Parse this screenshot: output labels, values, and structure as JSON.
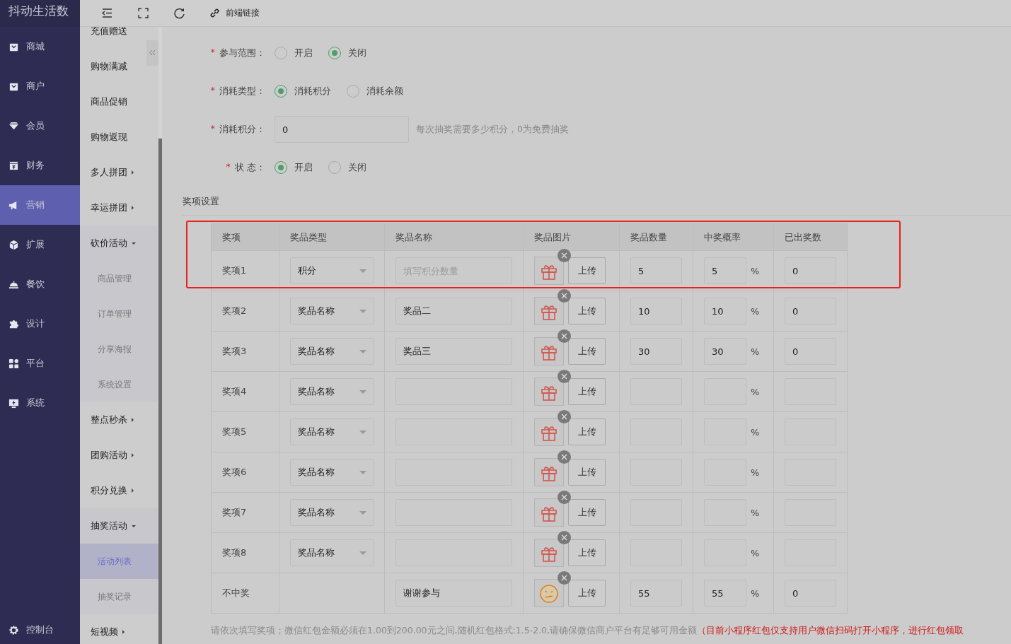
{
  "app": {
    "logo": "抖动生活数"
  },
  "main_menu": [
    {
      "label": "商城",
      "selected": false
    },
    {
      "label": "商户",
      "selected": false
    },
    {
      "label": "会员",
      "selected": false
    },
    {
      "label": "财务",
      "selected": false
    },
    {
      "label": "营销",
      "selected": true
    },
    {
      "label": "扩展",
      "selected": false
    },
    {
      "label": "餐饮",
      "selected": false
    },
    {
      "label": "设计",
      "selected": false
    },
    {
      "label": "平台",
      "selected": false
    },
    {
      "label": "系统",
      "selected": false
    }
  ],
  "console": {
    "label": "控制台"
  },
  "toolbar": {
    "link_label": "前端链接"
  },
  "sub_menu": [
    {
      "label": "充值赠送",
      "selected": false
    },
    {
      "label": "购物满减",
      "selected": false
    },
    {
      "label": "商品促销",
      "selected": false
    },
    {
      "label": "购物返现",
      "selected": false
    },
    {
      "label": "多人拼团",
      "expanded": false
    },
    {
      "label": "幸运拼团",
      "expanded": false
    },
    {
      "label": "砍价活动",
      "expanded": true,
      "children": [
        {
          "label": "商品管理",
          "selected": false
        },
        {
          "label": "订单管理",
          "selected": false
        },
        {
          "label": "分享海报",
          "selected": false
        },
        {
          "label": "系统设置",
          "selected": false
        }
      ]
    },
    {
      "label": "整点秒杀",
      "expanded": false
    },
    {
      "label": "团购活动",
      "expanded": false
    },
    {
      "label": "积分兑换",
      "expanded": false
    },
    {
      "label": "抽奖活动",
      "expanded": true,
      "children": [
        {
          "label": "活动列表",
          "selected": true
        },
        {
          "label": "抽奖记录",
          "selected": false
        }
      ]
    },
    {
      "label": "短视频",
      "expanded": false
    }
  ],
  "form": [
    {
      "kind": "radio",
      "required_mark": "*",
      "label": "参与范围：",
      "options": [
        {
          "label": "开启",
          "selected": false
        },
        {
          "label": "关闭",
          "selected": true
        }
      ]
    },
    {
      "kind": "radio",
      "required_mark": "*",
      "label": "消耗类型：",
      "options": [
        {
          "label": "消耗积分",
          "selected": true
        },
        {
          "label": "消耗余额",
          "selected": false
        }
      ]
    },
    {
      "kind": "input",
      "required_mark": "*",
      "label": "消耗积分：",
      "value": "0",
      "hint": "每次抽奖需要多少积分，0为免费抽奖"
    },
    {
      "kind": "radio",
      "required_mark": "*",
      "label": "状 态：",
      "options": [
        {
          "label": "开启",
          "selected": true
        },
        {
          "label": "关闭",
          "selected": false
        }
      ]
    }
  ],
  "prizes": {
    "title": "奖项设置",
    "columns": [
      "奖项",
      "奖品类型",
      "奖品名称",
      "奖品图片",
      "奖品数量",
      "中奖概率",
      "已出奖数"
    ],
    "rows": [
      {
        "kind": "prize",
        "label": "奖项1",
        "type": "积分",
        "name_placeholder": "填写积分数量",
        "upload": "上传",
        "quantity": "5",
        "probability": "5",
        "unit": "%",
        "awarded": "0",
        "highlighted": true
      },
      {
        "kind": "prize",
        "label": "奖项2",
        "type": "奖品名称",
        "name": "奖品二",
        "upload": "上传",
        "quantity": "10",
        "probability": "10",
        "unit": "%",
        "awarded": "0",
        "highlighted": false
      },
      {
        "kind": "prize",
        "label": "奖项3",
        "type": "奖品名称",
        "name": "奖品三",
        "upload": "上传",
        "quantity": "30",
        "probability": "30",
        "unit": "%",
        "awarded": "0",
        "highlighted": false
      },
      {
        "kind": "prize",
        "label": "奖项4",
        "type": "奖品名称",
        "upload": "上传",
        "unit": "%",
        "highlighted": false
      },
      {
        "kind": "prize",
        "label": "奖项5",
        "type": "奖品名称",
        "upload": "上传",
        "unit": "%",
        "highlighted": false
      },
      {
        "kind": "prize",
        "label": "奖项6",
        "type": "奖品名称",
        "upload": "上传",
        "unit": "%",
        "highlighted": false
      },
      {
        "kind": "prize",
        "label": "奖项7",
        "type": "奖品名称",
        "upload": "上传",
        "unit": "%",
        "highlighted": false
      },
      {
        "kind": "prize",
        "label": "奖项8",
        "type": "奖品名称",
        "upload": "上传",
        "unit": "%",
        "highlighted": false
      },
      {
        "kind": "no_prize",
        "label": "不中奖",
        "name": "谢谢参与",
        "upload": "上传",
        "quantity": "55",
        "probability": "55",
        "unit": "%",
        "awarded": "0",
        "highlighted": false
      }
    ],
    "note": "请依次填写奖项；微信红包金额必须在1.00到200.00元之间,随机红包格式:1.5-2.0,请确保微信商户平台有足够可用金额",
    "warning": "（目前小程序红包仅支持用户微信扫码打开小程序，进行红包领取"
  }
}
